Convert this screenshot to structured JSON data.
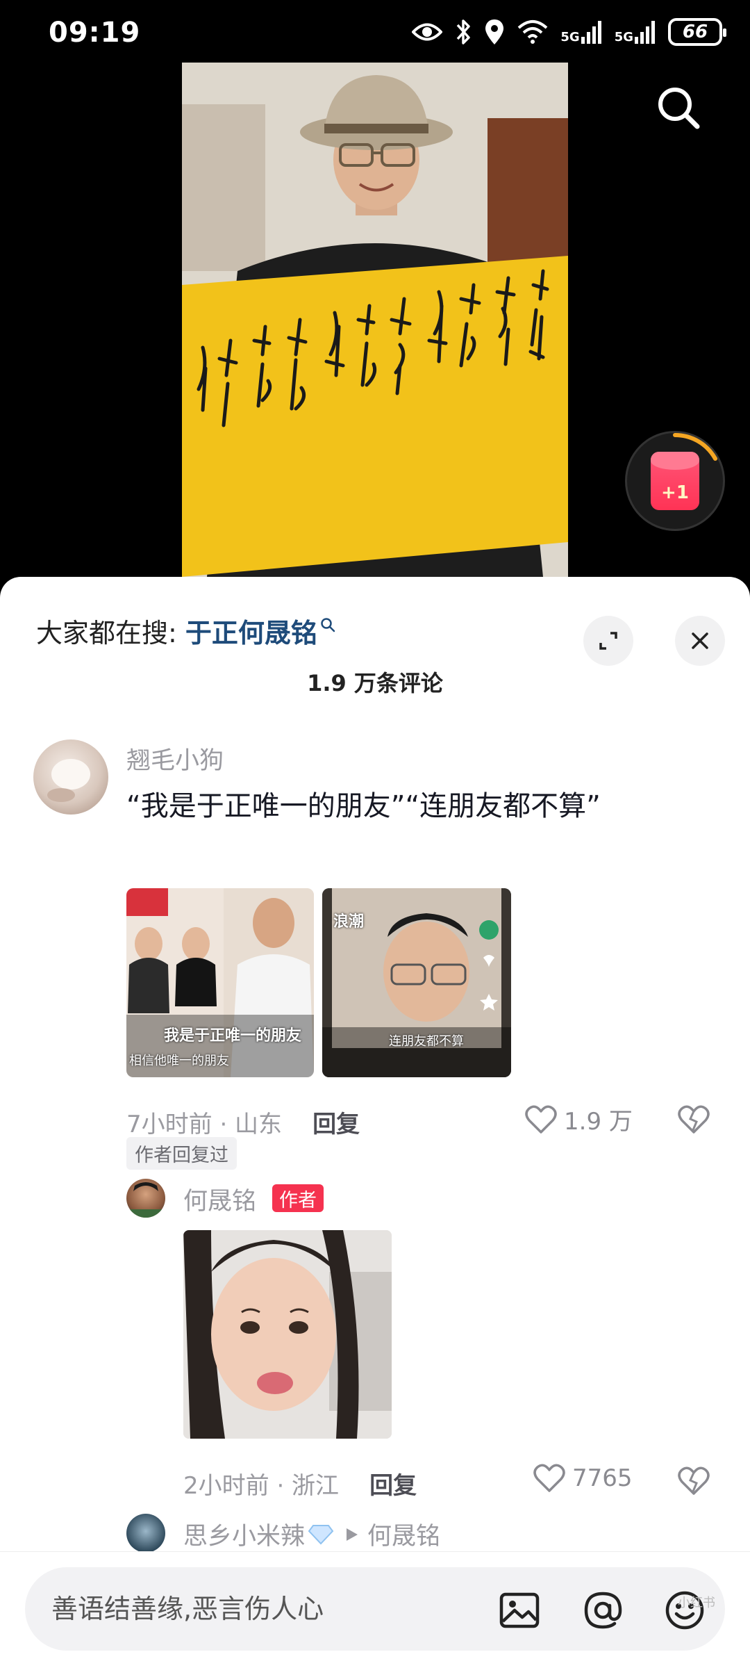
{
  "status_bar": {
    "time": "09:19",
    "network_1": "5G",
    "network_2": "5G",
    "battery": "66",
    "icons": [
      "eye-icon",
      "bluetooth-icon",
      "location-icon",
      "wifi-icon",
      "signal-icon",
      "battery-icon"
    ]
  },
  "video": {
    "search_icon": "search-icon",
    "redpacket_label": "+1"
  },
  "sheet": {
    "search_prefix": "大家都在搜:",
    "search_term": "于正何晟铭",
    "comment_count": "1.9 万条评论",
    "accent_color": "#1e4b7a"
  },
  "comments": [
    {
      "username": "翘毛小狗",
      "text": "“我是于正唯一的朋友”“连朋友都不算”",
      "thumb1_caption": "我是于正唯一的朋友",
      "thumb1_subcaption": "相信他唯一的朋友",
      "thumb2_badge": "浪潮",
      "thumb2_caption": "连朋友都不算",
      "time_location": "7小时前 · 山东",
      "reply_label": "回复",
      "likes": "1.9 万",
      "author_replied_tag": "作者回复过"
    },
    {
      "username": "何晟铭",
      "badge": "作者",
      "time_location": "2小时前 · 浙江",
      "reply_label": "回复",
      "likes": "7765"
    },
    {
      "username": "思乡小米辣",
      "reply_to": "何晟铭"
    }
  ],
  "input_bar": {
    "placeholder": "善语结善缘,恶言伤人心",
    "watermark": "小红书"
  }
}
